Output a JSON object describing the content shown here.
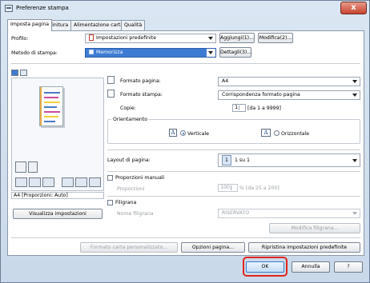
{
  "window": {
    "title": "Preferenze stampa",
    "close_glyph": "x"
  },
  "tabs": [
    {
      "label": "Imposta pagina"
    },
    {
      "label": "Finitura"
    },
    {
      "label": "Alimentazione carta"
    },
    {
      "label": "Qualità"
    }
  ],
  "profile": {
    "label": "Profilo:",
    "value": "Impostazioni predefinite",
    "add_button": "Aggiungi(1)...",
    "modify_button": "Modifica(2)..."
  },
  "output_method": {
    "label": "Metodo di stampa:",
    "value": "Memorizza",
    "details_button": "Dettagli(3)..."
  },
  "page_setup": {
    "page_size_label": "Formato pagina:",
    "page_size_value": "A4",
    "output_size_label": "Formato stampa:",
    "output_size_value": "Corrispondenza formato pagina",
    "copies_label": "Copie:",
    "copies_value": "1",
    "copies_range": "[da 1 a 9999]"
  },
  "orientation": {
    "label": "Orientamento",
    "portrait_label": "Verticale",
    "landscape_label": "Orizzontale",
    "selected": "portrait"
  },
  "layout": {
    "label": "Layout di pagina:",
    "number": "1",
    "value": "1 su 1"
  },
  "manual_scaling": {
    "label": "Proporzioni manuali",
    "scaling_label": "Proporzioni",
    "scaling_value": "100",
    "scaling_range": "% [da 25 a 200]",
    "checked": false
  },
  "watermark": {
    "label": "Filigrana",
    "name_label": "Nome filigrana",
    "name_value": "RISERVATO",
    "edit_button": "Modifica filigrana...",
    "checked": false
  },
  "preview": {
    "caption": "A4 [Proporzioni: Auto]",
    "view_settings_button": "Visualizza impostazioni"
  },
  "bottom_buttons": {
    "custom_paper": "Formato carta personalizzato...",
    "page_options": "Opzioni pagina...",
    "restore_defaults": "Ripristina impostazioni predefinite"
  },
  "dialog_buttons": {
    "ok": "OK",
    "cancel": "Annulla",
    "help": "?"
  },
  "colors": {
    "selection_blue": "#3d7bd2",
    "ok_highlight": "#e0261c",
    "close_red": "#c8442f"
  }
}
